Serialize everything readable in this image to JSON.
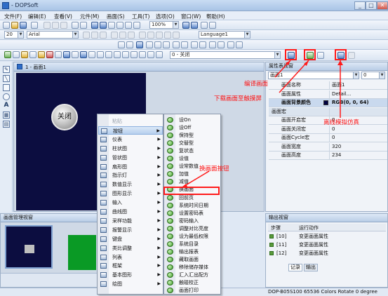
{
  "window": {
    "title": "- DOPSoft",
    "min": "_",
    "max": "□",
    "close": "✕"
  },
  "menubar": [
    "文件(F)",
    "编辑(E)",
    "查看(V)",
    "元件(M)",
    "画面(S)",
    "工具(T)",
    "选项(O)",
    "窗口(W)",
    "帮助(H)"
  ],
  "toolbar2": {
    "zoom": "100%",
    "language": "Language1"
  },
  "toolbar3": {
    "font_size": "20",
    "font_name": "Arial"
  },
  "toolbar4": {
    "state": "0 - 关闭"
  },
  "document": {
    "title": "1 - 画面1",
    "close_button_label": "关闭"
  },
  "properties": {
    "title": "属性表视窗",
    "object": "画面1",
    "count": "0",
    "rows": [
      {
        "key": "画面名称",
        "value": "画面1",
        "section": false,
        "highlight": false
      },
      {
        "key": "画面属性",
        "value": "Detail...",
        "section": false,
        "highlight": false
      },
      {
        "key": "画面背景颜色",
        "value": "RGB(0, 0, 64)",
        "section": false,
        "highlight": true
      },
      {
        "key": "画面宏",
        "value": "",
        "section": true,
        "highlight": false
      },
      {
        "key": "画面开启宏",
        "value": "0",
        "section": false,
        "highlight": false
      },
      {
        "key": "画面关闭宏",
        "value": "0",
        "section": false,
        "highlight": false
      },
      {
        "key": "画面Cycle宏",
        "value": "0",
        "section": false,
        "highlight": false
      },
      {
        "key": "画面宽度",
        "value": "320",
        "section": false,
        "highlight": false
      },
      {
        "key": "画面高度",
        "value": "234",
        "section": false,
        "highlight": false
      }
    ]
  },
  "context_menu": {
    "items": [
      {
        "label": "粘贴",
        "submenu": false,
        "disabled": true
      },
      {
        "label": "按钮",
        "submenu": true,
        "disabled": false
      },
      {
        "label": "仪表",
        "submenu": true,
        "disabled": false
      },
      {
        "label": "柱状图",
        "submenu": true,
        "disabled": false
      },
      {
        "label": "管状图",
        "submenu": true,
        "disabled": false
      },
      {
        "label": "扇形图",
        "submenu": true,
        "disabled": false
      },
      {
        "label": "指示灯",
        "submenu": true,
        "disabled": false
      },
      {
        "label": "数值显示",
        "submenu": true,
        "disabled": false
      },
      {
        "label": "图形显示",
        "submenu": true,
        "disabled": false
      },
      {
        "label": "输入",
        "submenu": true,
        "disabled": false
      },
      {
        "label": "曲线图",
        "submenu": true,
        "disabled": false
      },
      {
        "label": "采样功能",
        "submenu": true,
        "disabled": false
      },
      {
        "label": "报警显示",
        "submenu": true,
        "disabled": false
      },
      {
        "label": "键盘",
        "submenu": true,
        "disabled": false
      },
      {
        "label": "类比调整",
        "submenu": true,
        "disabled": false
      },
      {
        "label": "列表",
        "submenu": true,
        "disabled": false
      },
      {
        "label": "框架",
        "submenu": true,
        "disabled": false
      },
      {
        "label": "基本图形",
        "submenu": true,
        "disabled": false
      },
      {
        "label": "绘图",
        "submenu": true,
        "disabled": false
      }
    ]
  },
  "submenu": {
    "items": [
      "设On",
      "设Off",
      "保持型",
      "交替型",
      "复状态",
      "设值",
      "设常数值",
      "加值",
      "减值",
      "换画面",
      "回前页",
      "系统时间日期",
      "设置密码表",
      "密码输入",
      "调整对比亮度",
      "设为最低权限",
      "系统目录",
      "输出报表",
      "藏取画面",
      "移除储存媒体",
      "汇入汇出配方",
      "触碰校正",
      "画面打印"
    ]
  },
  "screen_manager": {
    "title": "画面管理视窗"
  },
  "output": {
    "title": "输出视窗",
    "col1": "步骤",
    "col2": "运行动作",
    "rows": [
      {
        "step": "[10]",
        "action": "变更画面属性"
      },
      {
        "step": "[11]",
        "action": "变更画面属性"
      },
      {
        "step": "[12]",
        "action": "变更画面属性"
      }
    ],
    "tabs": [
      "记录",
      "输出"
    ]
  },
  "statusbar": {
    "left": "Download",
    "right": "DOP-B05S100 65536 Colors Rotate 0 degree"
  },
  "annotations": {
    "compile": "编译画面",
    "download": "下载画面至触摸屏",
    "offline_sim": "离线模拟仿真",
    "change_screen": "换画面按钮"
  }
}
